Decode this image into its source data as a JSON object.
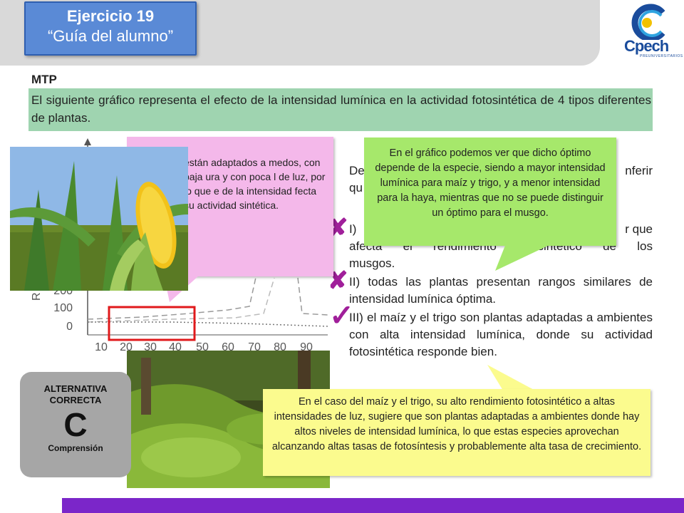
{
  "header": {
    "title": "Ejercicio 19",
    "subtitle": "“Guía del alumno”"
  },
  "logo": {
    "name": "Cpech",
    "tagline": "PREUNIVERSITARIOS"
  },
  "section_label": "MTP",
  "intro_text": "El siguiente gráfico representa el efecto de la intensidad lumínica en la actividad fotosintética de 4 tipos diferentes de plantas.",
  "question_fragment": {
    "line1_start": "De",
    "line1_end": "nferir",
    "line2_start": "qu"
  },
  "statements": [
    {
      "prefix": "I)",
      "visible_end": "r que",
      "line2": "afecta el rendimiento fotosintético de los",
      "line3": "musgos."
    },
    {
      "text": "II) todas las plantas presentan rangos similares de intensidad lumínica óptima."
    },
    {
      "text": "III) el maíz y el trigo son plantas adaptadas a ambientes con alta intensidad lumínica, donde su actividad fotosintética responde bien."
    }
  ],
  "marks": [
    "✘",
    "✘",
    "✓"
  ],
  "callouts": {
    "pink": "están adaptados a medos, con baja ura y con poca l de luz, por lo que e de la intensidad fecta su actividad sintética.",
    "green": "En el gráfico podemos ver que dicho óptimo depende de la especie, siendo a mayor intensidad lumínica para maíz y trigo, y a menor intensidad para la haya, mientras que no se puede distinguir un óptimo para el musgo.",
    "yellow": "En el caso del maíz y el trigo, su alto rendimiento fotosintético a altas intensidades de luz, sugiere que son plantas adaptadas a ambientes donde hay altos niveles de intensidad lumínica, lo que estas especies aprovechan alcanzando altas tasas de fotosíntesis y probablemente alta tasa de crecimiento."
  },
  "answer": {
    "label": "ALTERNATIVA CORRECTA",
    "letter": "C",
    "skill": "Comprensión"
  },
  "chart_data": {
    "type": "line",
    "xlabel": "",
    "ylabel": "R",
    "x_ticks": [
      "10",
      "20",
      "30",
      "40",
      "50",
      "60",
      "70",
      "80",
      "90"
    ],
    "y_ticks": [
      "0",
      "100",
      "200"
    ],
    "xlim": [
      10,
      90
    ],
    "ylim": [
      0,
      250
    ],
    "highlight_x_range": [
      15,
      45
    ]
  },
  "colors": {
    "title_box": "#5a8ad6",
    "intro_bg": "#9fd4b0",
    "pink_callout": "#f4b8ea",
    "green_callout": "#a6e86b",
    "yellow_callout": "#fbfb8e",
    "answer_box": "#a6a6a6",
    "footer": "#7b26c9",
    "marks": "#a01f9a",
    "highlight_rect": "#e0191b"
  }
}
